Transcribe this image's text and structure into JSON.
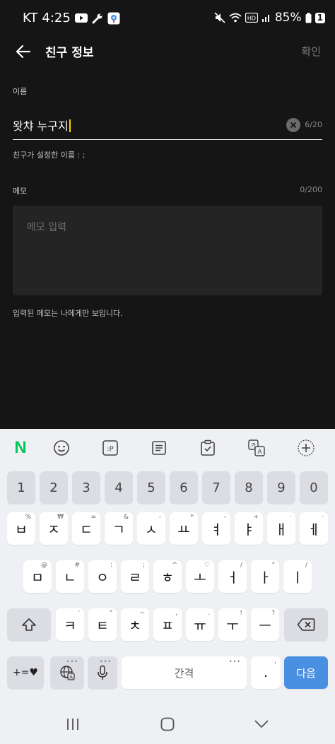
{
  "statusbar": {
    "carrier": "KT",
    "time": "4:25",
    "battery": "85%",
    "notif_badge": "1",
    "hd_label": "HD",
    "icons": [
      "youtube-icon",
      "wrench-icon",
      "maps-icon",
      "mute-icon",
      "wifi-icon",
      "hd-icon",
      "signal-icon",
      "battery-icon"
    ]
  },
  "header": {
    "title": "친구 정보",
    "confirm": "확인"
  },
  "name": {
    "label": "이름",
    "value": "왓챠 누구지",
    "count": "6/20",
    "helper": "친구가 설정한 이름 : ;"
  },
  "memo": {
    "label": "메모",
    "count": "0/200",
    "placeholder": "메모 입력",
    "note": "입력된 메모는 나에게만 보입니다."
  },
  "keyboard": {
    "toolbar_icons": [
      "naver-icon",
      "emoji-icon",
      "kaomoji-icon",
      "notes-icon",
      "clipboard-icon",
      "translate-icon",
      "add-icon"
    ],
    "naver_letter": "N",
    "kaomoji_label": ":P",
    "number_row": [
      "1",
      "2",
      "3",
      "4",
      "5",
      "6",
      "7",
      "8",
      "9",
      "0"
    ],
    "row1": [
      {
        "key": "ㅂ",
        "sec": "%"
      },
      {
        "key": "ㅈ",
        "sec": "₩"
      },
      {
        "key": "ㄷ",
        "sec": "="
      },
      {
        "key": "ㄱ",
        "sec": "&"
      },
      {
        "key": "ㅅ",
        "sec": "-"
      },
      {
        "key": "ㅛ",
        "sec": "*"
      },
      {
        "key": "ㅕ",
        "sec": "-"
      },
      {
        "key": "ㅑ",
        "sec": "+"
      },
      {
        "key": "ㅐ",
        "sec": "·"
      },
      {
        "key": "ㅔ",
        "sec": "·"
      }
    ],
    "row2": [
      {
        "key": "ㅁ",
        "sec": "@"
      },
      {
        "key": "ㄴ",
        "sec": "#"
      },
      {
        "key": "ㅇ",
        "sec": ":"
      },
      {
        "key": "ㄹ",
        "sec": ";"
      },
      {
        "key": "ㅎ",
        "sec": "^"
      },
      {
        "key": "ㅗ",
        "sec": "♡"
      },
      {
        "key": "ㅓ",
        "sec": "/"
      },
      {
        "key": "ㅏ",
        "sec": "\""
      },
      {
        "key": "ㅣ",
        "sec": "/"
      }
    ],
    "row3": [
      {
        "key": "ㅋ",
        "sec": "'"
      },
      {
        "key": "ㅌ",
        "sec": "\""
      },
      {
        "key": "ㅊ",
        "sec": "~"
      },
      {
        "key": "ㅍ",
        "sec": ","
      },
      {
        "key": "ㅠ",
        "sec": "."
      },
      {
        "key": "ㅜ",
        "sec": "!"
      },
      {
        "key": "ㅡ",
        "sec": "?"
      }
    ],
    "symbols_key": "+=♥",
    "space_label": "간격",
    "period_key": ".",
    "period_sec": ",",
    "enter_label": "다음",
    "accent_color": "#4a90e2",
    "cursor_color": "#f5d300"
  },
  "navbar": {
    "icons": [
      "recents-icon",
      "home-icon",
      "back-chevron-icon"
    ]
  }
}
